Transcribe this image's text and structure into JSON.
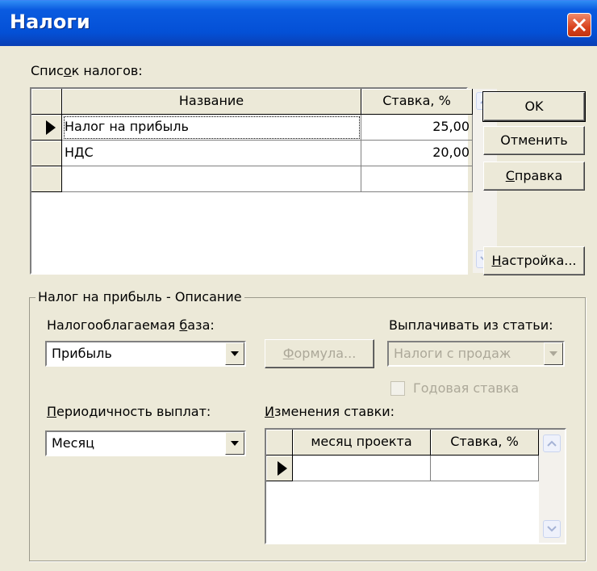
{
  "window": {
    "title": "Налоги"
  },
  "tax_list": {
    "label_pre": "Спис",
    "label_key": "о",
    "label_post": "к налогов:",
    "columns": [
      "Название",
      "Ставка, %"
    ],
    "rows": [
      {
        "name": "Налог на прибыль",
        "rate": "25,00"
      },
      {
        "name": "НДС",
        "rate": "20,00"
      }
    ]
  },
  "buttons": {
    "ok": "OK",
    "cancel": "Отменить",
    "help_key": "С",
    "help_rest": "правка",
    "settings_key": "Н",
    "settings_rest": "астройка..."
  },
  "description": {
    "group_label": "Налог на прибыль - Описание",
    "base_label_pre": "Налогооблагаемая ",
    "base_label_key": "б",
    "base_label_post": "аза:",
    "base_value": "Прибыль",
    "formula_key": "Ф",
    "formula_rest": "ормула...",
    "pay_from_label": "Выплачивать из статьи:",
    "pay_from_value": "Налоги с продаж",
    "annual_rate_label": "Годовая ставка",
    "period_label_key": "П",
    "period_label_rest": "ериодичность выплат:",
    "period_value": "Месяц",
    "changes_label_key": "И",
    "changes_label_rest": "зменения ставки:",
    "changes_columns": [
      "месяц проекта",
      "Ставка, %"
    ]
  }
}
